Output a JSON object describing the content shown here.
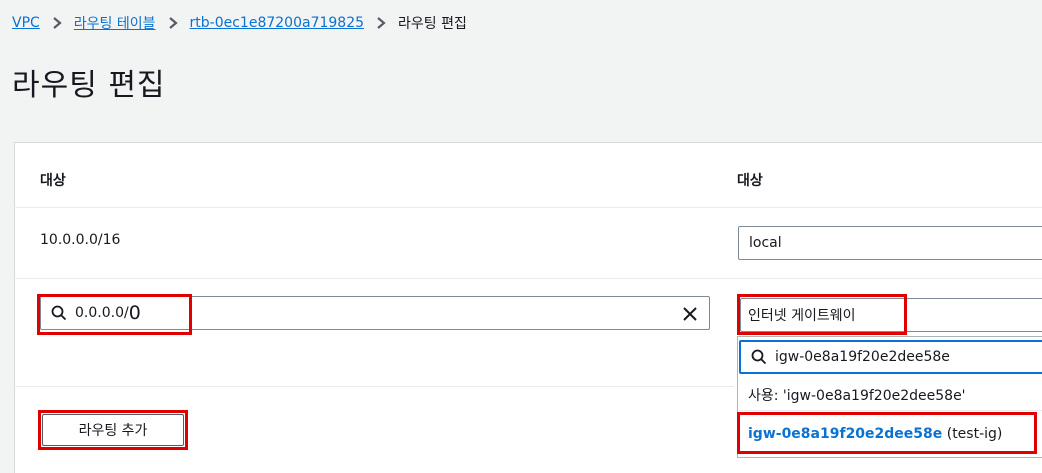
{
  "breadcrumb": {
    "items": [
      "VPC",
      "라우팅 테이블",
      "rtb-0ec1e87200a719825"
    ],
    "current": "라우팅 편집"
  },
  "page_title": "라우팅 편집",
  "table": {
    "col_destination": "대상",
    "col_target": "대상",
    "rows": [
      {
        "destination": "10.0.0.0/16",
        "target": "local"
      }
    ],
    "new_row": {
      "destination_value": "0.0.0.0/",
      "destination_value_tail": "0",
      "target_value": "인터넷 게이트웨이",
      "target_search_value": "igw-0e8a19f20e2dee58e",
      "use_option": "사용: 'igw-0e8a19f20e2dee58e'",
      "result_id": "igw-0e8a19f20e2dee58e",
      "result_name": "(test-ig)"
    }
  },
  "add_route_button": "라우팅 추가",
  "colors": {
    "link": "#0972d3",
    "highlight_border": "#e00000",
    "result_text": "#0972d3"
  }
}
